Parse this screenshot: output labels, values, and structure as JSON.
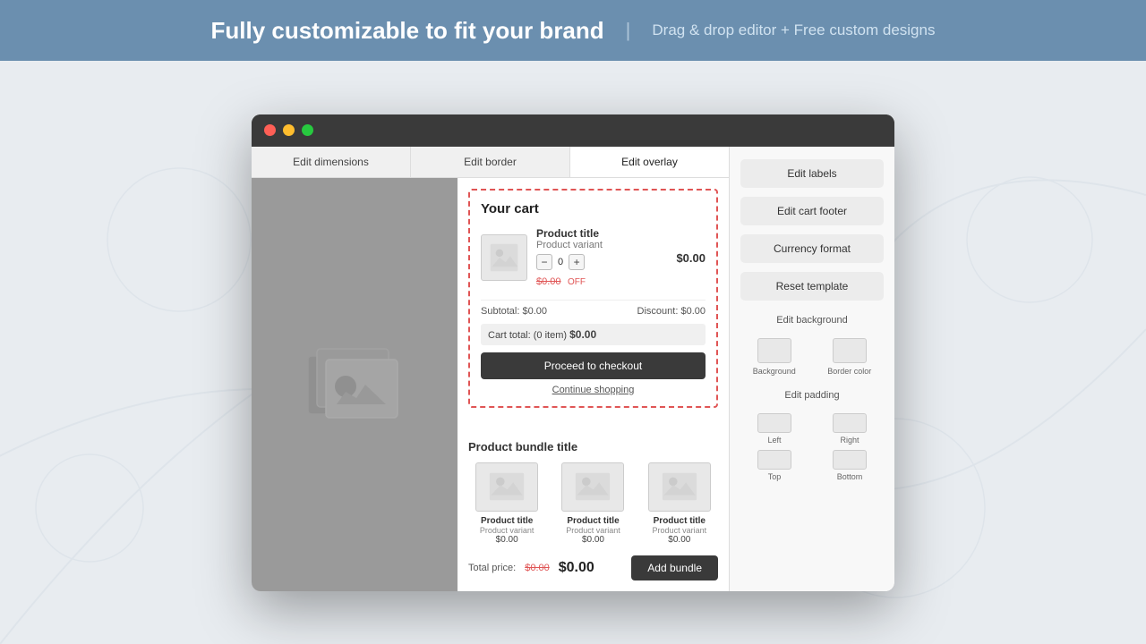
{
  "banner": {
    "title": "Fully customizable to fit your brand",
    "divider": "|",
    "subtitle": "Drag & drop editor + Free custom designs"
  },
  "window": {
    "dots": [
      "red",
      "yellow",
      "green"
    ]
  },
  "tabs": [
    {
      "label": "Edit dimensions",
      "active": false
    },
    {
      "label": "Edit border",
      "active": false
    },
    {
      "label": "Edit overlay",
      "active": true
    }
  ],
  "cart": {
    "title": "Your cart",
    "item": {
      "title": "Product title",
      "variant": "Product variant",
      "qty": "0",
      "original_price": "$0.00",
      "off_label": "OFF",
      "price": "$0.00"
    },
    "summary": {
      "subtotal_label": "Subtotal:",
      "subtotal_value": "$0.00",
      "discount_label": "Discount:",
      "discount_value": "$0.00"
    },
    "total": {
      "label": "Cart total: (0 item)",
      "value": "$0.00"
    },
    "checkout_label": "Proceed to checkout",
    "continue_label": "Continue shopping"
  },
  "bundle": {
    "title": "Product bundle title",
    "products": [
      {
        "title": "Product title",
        "variant": "Product variant",
        "price": "$0.00"
      },
      {
        "title": "Product title",
        "variant": "Product variant",
        "price": "$0.00"
      },
      {
        "title": "Product title",
        "variant": "Product variant",
        "price": "$0.00"
      }
    ],
    "footer": {
      "total_label": "Total price:",
      "original_price": "$0.00",
      "new_price": "$0.00",
      "button_label": "Add bundle"
    }
  },
  "side_panel": {
    "action_buttons": [
      {
        "label": "Edit labels"
      },
      {
        "label": "Edit cart footer"
      },
      {
        "label": "Currency format"
      },
      {
        "label": "Reset template"
      }
    ],
    "background_section": {
      "title": "Edit background",
      "swatches": [
        {
          "label": "Background"
        },
        {
          "label": "Border color"
        }
      ]
    },
    "padding_section": {
      "title": "Edit padding",
      "inputs": [
        {
          "label": "Left"
        },
        {
          "label": "Right"
        },
        {
          "label": "Top"
        },
        {
          "label": "Bottom"
        }
      ]
    }
  }
}
